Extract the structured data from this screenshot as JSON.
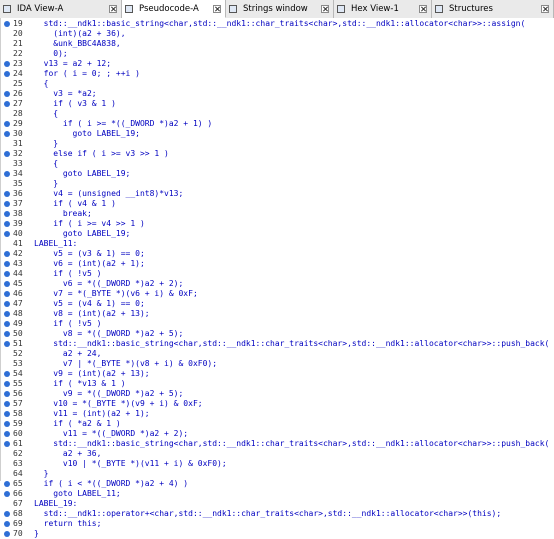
{
  "tabs": [
    {
      "label": "IDA View-A",
      "icon": "ida-view-icon",
      "active": false
    },
    {
      "label": "Pseudocode-A",
      "icon": "pseudocode-icon",
      "active": true
    },
    {
      "label": "Strings window",
      "icon": "strings-icon",
      "active": false
    },
    {
      "label": "Hex View-1",
      "icon": "hex-view-icon",
      "active": false
    },
    {
      "label": "Structures",
      "icon": "structures-icon",
      "active": false
    }
  ],
  "colors": {
    "code": "#0000c0",
    "line_number": "#333333",
    "breakpoint_dot": "#2f6fd6",
    "tab_active_bg": "#ffffff",
    "tab_bg": "#eaeaea"
  },
  "lines": [
    {
      "n": "19",
      "dot": true,
      "code": "  std::__ndk1::basic_string<char,std::__ndk1::char_traits<char>,std::__ndk1::allocator<char>>::assign("
    },
    {
      "n": "20",
      "dot": false,
      "code": "    (int)(a2 + 36),"
    },
    {
      "n": "21",
      "dot": false,
      "code": "    &unk_BBC4A838,"
    },
    {
      "n": "22",
      "dot": false,
      "code": "    0);"
    },
    {
      "n": "23",
      "dot": true,
      "code": "  v13 = a2 + 12;"
    },
    {
      "n": "24",
      "dot": true,
      "code": "  for ( i = 0; ; ++i )"
    },
    {
      "n": "25",
      "dot": false,
      "code": "  {"
    },
    {
      "n": "26",
      "dot": true,
      "code": "    v3 = *a2;"
    },
    {
      "n": "27",
      "dot": true,
      "code": "    if ( v3 & 1 )"
    },
    {
      "n": "28",
      "dot": false,
      "code": "    {"
    },
    {
      "n": "29",
      "dot": true,
      "code": "      if ( i >= *((_DWORD *)a2 + 1) )"
    },
    {
      "n": "30",
      "dot": true,
      "code": "        goto LABEL_19;"
    },
    {
      "n": "31",
      "dot": false,
      "code": "    }"
    },
    {
      "n": "32",
      "dot": true,
      "code": "    else if ( i >= v3 >> 1 )"
    },
    {
      "n": "33",
      "dot": false,
      "code": "    {"
    },
    {
      "n": "34",
      "dot": true,
      "code": "      goto LABEL_19;"
    },
    {
      "n": "35",
      "dot": false,
      "code": "    }"
    },
    {
      "n": "36",
      "dot": true,
      "code": "    v4 = (unsigned __int8)*v13;"
    },
    {
      "n": "37",
      "dot": true,
      "code": "    if ( v4 & 1 )"
    },
    {
      "n": "38",
      "dot": true,
      "code": "      break;"
    },
    {
      "n": "39",
      "dot": true,
      "code": "    if ( i >= v4 >> 1 )"
    },
    {
      "n": "40",
      "dot": true,
      "code": "      goto LABEL_19;"
    },
    {
      "n": "41",
      "dot": false,
      "code": "LABEL_11:"
    },
    {
      "n": "42",
      "dot": true,
      "code": "    v5 = (v3 & 1) == 0;"
    },
    {
      "n": "43",
      "dot": true,
      "code": "    v6 = (int)(a2 + 1);"
    },
    {
      "n": "44",
      "dot": true,
      "code": "    if ( !v5 )"
    },
    {
      "n": "45",
      "dot": true,
      "code": "      v6 = *((_DWORD *)a2 + 2);"
    },
    {
      "n": "46",
      "dot": true,
      "code": "    v7 = *(_BYTE *)(v6 + i) & 0xF;"
    },
    {
      "n": "47",
      "dot": true,
      "code": "    v5 = (v4 & 1) == 0;"
    },
    {
      "n": "48",
      "dot": true,
      "code": "    v8 = (int)(a2 + 13);"
    },
    {
      "n": "49",
      "dot": true,
      "code": "    if ( !v5 )"
    },
    {
      "n": "50",
      "dot": true,
      "code": "      v8 = *((_DWORD *)a2 + 5);"
    },
    {
      "n": "51",
      "dot": true,
      "code": "    std::__ndk1::basic_string<char,std::__ndk1::char_traits<char>,std::__ndk1::allocator<char>>::push_back("
    },
    {
      "n": "52",
      "dot": false,
      "code": "      a2 + 24,"
    },
    {
      "n": "53",
      "dot": false,
      "code": "      v7 | *(_BYTE *)(v8 + i) & 0xF0);"
    },
    {
      "n": "54",
      "dot": true,
      "code": "    v9 = (int)(a2 + 13);"
    },
    {
      "n": "55",
      "dot": true,
      "code": "    if ( *v13 & 1 )"
    },
    {
      "n": "56",
      "dot": true,
      "code": "      v9 = *((_DWORD *)a2 + 5);"
    },
    {
      "n": "57",
      "dot": true,
      "code": "    v10 = *(_BYTE *)(v9 + i) & 0xF;"
    },
    {
      "n": "58",
      "dot": true,
      "code": "    v11 = (int)(a2 + 1);"
    },
    {
      "n": "59",
      "dot": true,
      "code": "    if ( *a2 & 1 )"
    },
    {
      "n": "60",
      "dot": true,
      "code": "      v11 = *((_DWORD *)a2 + 2);"
    },
    {
      "n": "61",
      "dot": true,
      "code": "    std::__ndk1::basic_string<char,std::__ndk1::char_traits<char>,std::__ndk1::allocator<char>>::push_back("
    },
    {
      "n": "62",
      "dot": false,
      "code": "      a2 + 36,"
    },
    {
      "n": "63",
      "dot": false,
      "code": "      v10 | *(_BYTE *)(v11 + i) & 0xF0);"
    },
    {
      "n": "64",
      "dot": false,
      "code": "  }"
    },
    {
      "n": "65",
      "dot": true,
      "code": "  if ( i < *((_DWORD *)a2 + 4) )"
    },
    {
      "n": "66",
      "dot": true,
      "code": "    goto LABEL_11;"
    },
    {
      "n": "67",
      "dot": false,
      "code": "LABEL_19:"
    },
    {
      "n": "68",
      "dot": true,
      "code": "  std::__ndk1::operator+<char,std::__ndk1::char_traits<char>,std::__ndk1::allocator<char>>(this);"
    },
    {
      "n": "69",
      "dot": true,
      "code": "  return this;"
    },
    {
      "n": "70",
      "dot": true,
      "code": "}"
    }
  ]
}
